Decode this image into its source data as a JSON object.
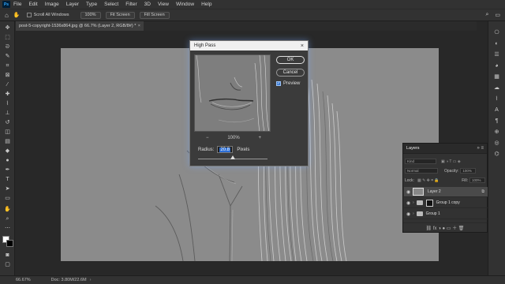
{
  "menubar": {
    "logo": "Ps",
    "items": [
      "File",
      "Edit",
      "Image",
      "Layer",
      "Type",
      "Select",
      "Filter",
      "3D",
      "View",
      "Window",
      "Help"
    ]
  },
  "optionsbar": {
    "scroll_all_windows": "Scroll All Windows",
    "zoom_100": "100%",
    "fit_screen": "Fit Screen",
    "fill_screen": "Fill Screen"
  },
  "document": {
    "tab_title": "post-5-copyright-1536x864.jpg @ 66.7% (Layer 2, RGB/8#) *",
    "tab_close": "×"
  },
  "statusbar": {
    "zoom": "66.67%",
    "doc_info": "Doc: 3.80M/22.6M"
  },
  "dialog": {
    "title": "High Pass",
    "close": "×",
    "ok_label": "OK",
    "cancel_label": "Cancel",
    "preview_label": "Preview",
    "preview_checked": "✓",
    "zoom_out": "−",
    "zoom_level": "100%",
    "zoom_in": "+",
    "radius_label": "Radius:",
    "radius_value": "20.8",
    "radius_unit": "Pixels",
    "slider_fraction": 0.5
  },
  "layers_panel": {
    "title": "Layers",
    "header_icons": "» ≡",
    "kind_filter": "Kind",
    "blend_mode": "Normal",
    "opacity_label": "Opacity:",
    "opacity_value": "100%",
    "lock_label": "Lock:",
    "fill_label": "Fill:",
    "fill_value": "100%",
    "layers": [
      {
        "name": "Layer 2",
        "selected": true
      },
      {
        "name": "Group 1 copy",
        "selected": false
      },
      {
        "name": "Group 1",
        "selected": false
      }
    ],
    "footer_icons": "⛓ fx ◑ ● ▭ ＋ 🗑"
  },
  "colors": {
    "accent": "#2c6ed5",
    "ui_bg": "#323232",
    "canvas_bg": "#282828"
  }
}
